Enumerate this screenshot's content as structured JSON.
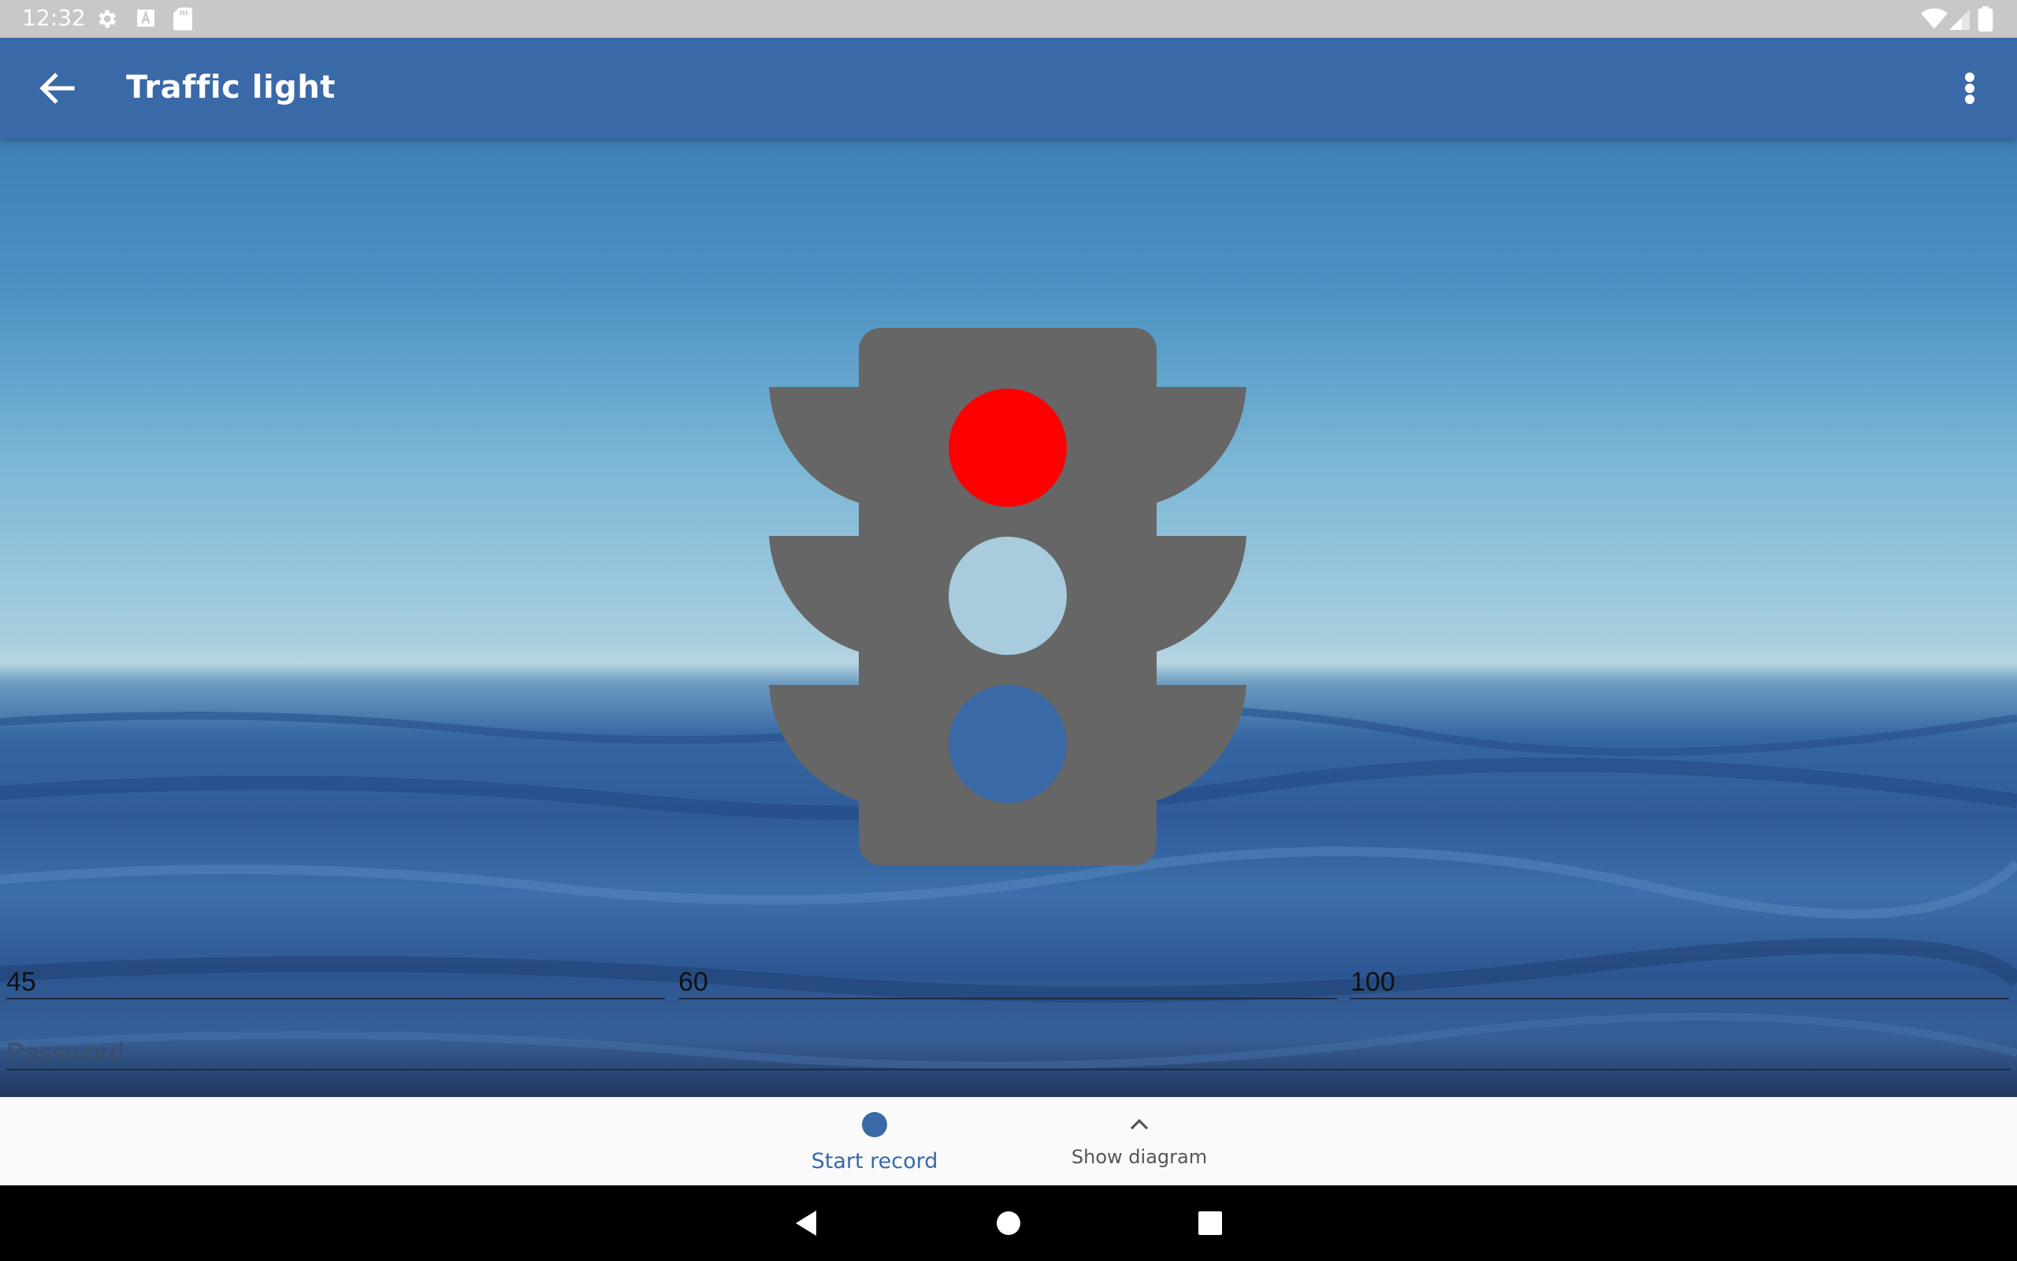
{
  "status_bar": {
    "time": "12:32",
    "icons_left": [
      "settings-icon",
      "keyboard-a-icon",
      "sd-card-icon"
    ],
    "icons_right": [
      "wifi-icon",
      "cell-signal-icon",
      "battery-icon"
    ]
  },
  "app_bar": {
    "title": "Traffic light",
    "back_icon": "arrow-back-icon",
    "menu_icon": "more-vert-icon",
    "color": "#3a69a8"
  },
  "traffic_light": {
    "body_color": "#666666",
    "active_light": "red",
    "lights": [
      {
        "name": "red",
        "color": "#ff0000",
        "on": true
      },
      {
        "name": "middle",
        "on": false
      },
      {
        "name": "bottom",
        "on": false
      }
    ]
  },
  "fields": {
    "value1": "45",
    "value2": "60",
    "value3": "100",
    "password_placeholder": "Password"
  },
  "bottom_bar": {
    "start_record_label": "Start record",
    "start_record_icon": "record-dot-icon",
    "show_diagram_label": "Show diagram",
    "show_diagram_icon": "chevron-up-icon",
    "accent": "#3a69a8"
  },
  "nav_bar": {
    "icons": [
      "back-triangle-icon",
      "home-circle-icon",
      "recents-square-icon"
    ]
  }
}
